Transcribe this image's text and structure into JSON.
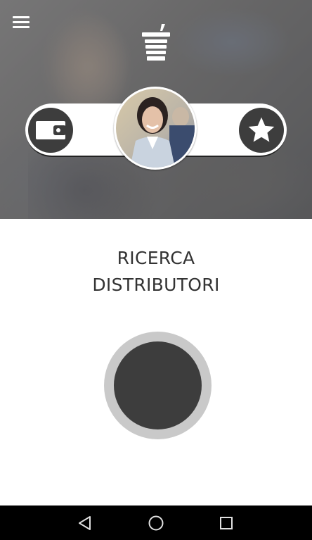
{
  "header": {
    "menu_icon": "hamburger-menu-icon",
    "logo_icon": "cup-straw-logo-icon",
    "wallet_icon": "wallet-icon",
    "favorites_icon": "star-icon",
    "profile_image": "user-avatar-photo"
  },
  "main": {
    "title_line1": "RICERCA",
    "title_line2": "DISTRIBUTORI",
    "search_button_icon": "search-distributors-button"
  },
  "navbar": {
    "back_icon": "back-triangle-icon",
    "home_icon": "home-circle-icon",
    "recents_icon": "recents-square-icon"
  },
  "colors": {
    "dark": "#3d3d3d",
    "ring": "#c9c9c9",
    "text": "#333333",
    "navbar": "#000000"
  }
}
